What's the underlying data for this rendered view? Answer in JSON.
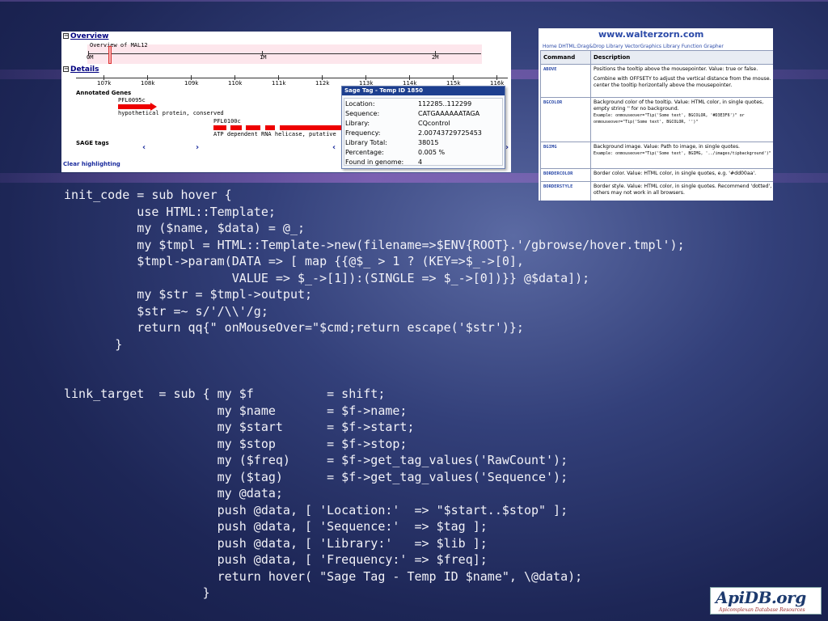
{
  "gbrowse": {
    "overview_title": "Overview",
    "overview_label": "Overview of MAL12",
    "overview_ticks": [
      "0M",
      "1M",
      "2M"
    ],
    "details_title": "Details",
    "details_ticks": [
      "107k",
      "108k",
      "109k",
      "110k",
      "111k",
      "112k",
      "113k",
      "114k",
      "115k",
      "116k"
    ],
    "annotated_genes": "Annotated Genes",
    "gene1_name": "PFL0095c",
    "gene1_desc": "hypothetical protein, conserved",
    "gene2_name": "PFL0100c",
    "gene2_desc": "ATP dependent RNA helicase, putative",
    "sage_tags": "SAGE tags",
    "clear_highlighting": "Clear highlighting",
    "nav_left": "‹",
    "nav_right": "›"
  },
  "tooltip": {
    "title": "Sage Tag - Temp ID 1850",
    "rows": [
      {
        "key": "Location:",
        "value": "112285..112299"
      },
      {
        "key": "Sequence:",
        "value": "CATGAAAAAATAGA"
      },
      {
        "key": "Library:",
        "value": "CQcontrol"
      },
      {
        "key": "Frequency:",
        "value": "2.00743729725453"
      },
      {
        "key": "Library Total:",
        "value": "38015"
      },
      {
        "key": "Percentage:",
        "value": "0.005 %"
      },
      {
        "key": "Found in genome:",
        "value": "4"
      }
    ]
  },
  "walterzorn": {
    "site_title": "www.walterzorn.com",
    "nav": "Home   DHTML:Drag&Drop Library   VectorGraphics Library   Function Grapher",
    "col_command": "Command",
    "col_description": "Description",
    "rows": [
      {
        "cmd": "ABOVE",
        "desc1": "Positions the tooltip above the mousepointer. Value: true or false.",
        "desc2": "Combine with OFFSETY to adjust the vertical distance from the mouse. center the tooltip horizontally above the mousepointer."
      },
      {
        "cmd": "BGCOLOR",
        "desc1": "Background color of the tooltip. Value: HTML color, in single quotes, empty string '' for no background.",
        "desc2": "Example: onmouseover=\"Tip('Some text', BGCOLOR, '#D3E3F6')\" or onmouseover=\"Tip('Some text', BGCOLOR, '')\""
      },
      {
        "cmd": "BGIMG",
        "desc1": "Background image. Value: Path to image, in single quotes.",
        "desc2": "Example: onmouseover=\"Tip('Some text', BGIMG, '../images/tipbackground')\""
      },
      {
        "cmd": "BORDERCOLOR",
        "desc1": "Border color. Value: HTML color, in single quotes, e.g. '#dd00aa'.",
        "desc2": ""
      },
      {
        "cmd": "BORDERSTYLE",
        "desc1": "Border style. Value: HTML color, in single quotes. Recommend 'dotted', others may not work in all browsers.",
        "desc2": ""
      }
    ]
  },
  "code": {
    "init_code": "init_code = sub hover {\n          use HTML::Template;\n          my ($name, $data) = @_;\n          my $tmpl = HTML::Template->new(filename=>$ENV{ROOT}.'/gbrowse/hover.tmpl');\n          $tmpl->param(DATA => [ map {{@$_ > 1 ? (KEY=>$_->[0],\n                       VALUE => $_->[1]):(SINGLE => $_->[0])}} @$data]);\n          my $str = $tmpl->output;\n          $str =~ s/'/\\\\'/g;\n          return qq{\" onMouseOver=\"$cmd;return escape('$str')};\n       }",
    "link_target": "link_target  = sub { my $f          = shift;\n                     my $name       = $f->name;\n                     my $start      = $f->start;\n                     my $stop       = $f->stop;\n                     my ($freq)     = $f->get_tag_values('RawCount');\n                     my ($tag)      = $f->get_tag_values('Sequence');\n                     my @data;\n                     push @data, [ 'Location:'  => \"$start..$stop\" ];\n                     push @data, [ 'Sequence:'  => $tag ];\n                     push @data, [ 'Library:'   => $lib ];\n                     push @data, [ 'Frequency:' => $freq];\n                     return hover( \"Sage Tag - Temp ID $name\", \\@data);\n                   }"
  },
  "logo": {
    "name": "ApiDB.org",
    "subtitle": "Apicomplexan Database Resources"
  }
}
